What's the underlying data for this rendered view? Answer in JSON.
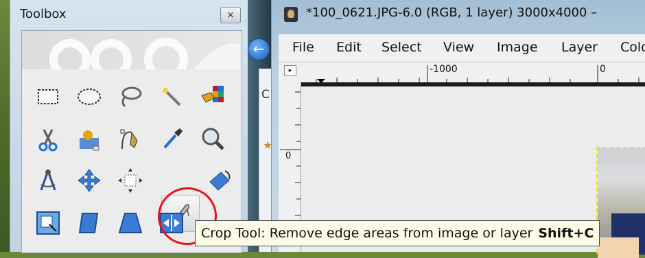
{
  "toolbox": {
    "title": "Toolbox",
    "close_label": "×",
    "tools": [
      {
        "name": "rect-select-tool",
        "icon": "rectangle-select-icon"
      },
      {
        "name": "ellipse-select-tool",
        "icon": "ellipse-select-icon"
      },
      {
        "name": "free-select-tool",
        "icon": "lasso-icon"
      },
      {
        "name": "fuzzy-select-tool",
        "icon": "magic-wand-icon"
      },
      {
        "name": "select-by-color-tool",
        "icon": "color-select-icon"
      },
      {
        "name": "scissors-select-tool",
        "icon": "scissors-icon"
      },
      {
        "name": "foreground-select-tool",
        "icon": "foreground-select-icon"
      },
      {
        "name": "paths-tool",
        "icon": "pen-path-icon"
      },
      {
        "name": "color-picker-tool",
        "icon": "eyedropper-icon"
      },
      {
        "name": "zoom-tool",
        "icon": "magnifier-icon"
      },
      {
        "name": "measure-tool",
        "icon": "compass-icon"
      },
      {
        "name": "move-tool",
        "icon": "move-arrows-icon"
      },
      {
        "name": "align-tool",
        "icon": "align-icon"
      },
      {
        "name": "crop-tool",
        "icon": "crop-knife-icon"
      },
      {
        "name": "rotate-tool",
        "icon": "rotate-icon"
      },
      {
        "name": "scale-tool",
        "icon": "scale-icon"
      },
      {
        "name": "shear-tool",
        "icon": "shear-icon"
      },
      {
        "name": "perspective-tool",
        "icon": "perspective-icon"
      },
      {
        "name": "flip-tool",
        "icon": "flip-icon"
      }
    ],
    "active_tool": "crop-tool"
  },
  "partial_window": {
    "char": "C",
    "star": "★"
  },
  "image_window": {
    "title": "*100_0621.JPG-6.0 (RGB, 1 layer) 3000x4000 –",
    "menu": [
      "File",
      "Edit",
      "Select",
      "View",
      "Image",
      "Layer",
      "Colo"
    ],
    "ruler_top_labels": [
      "-1000",
      "0"
    ],
    "ruler_left_labels": [
      "0"
    ]
  },
  "tooltip": {
    "text": "Crop Tool: Remove edge areas from image or layer",
    "shortcut": "Shift+C"
  },
  "colors": {
    "highlight_circle": "#e4141b",
    "selection_marching_ants": "#f4e400"
  }
}
